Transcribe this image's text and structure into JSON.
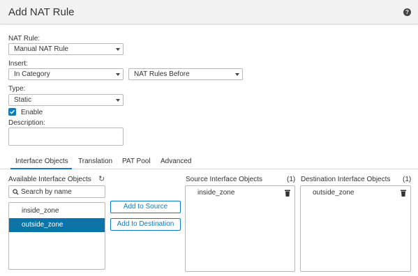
{
  "dialog": {
    "title": "Add NAT Rule",
    "help_icon": "?"
  },
  "form": {
    "nat_rule": {
      "label": "NAT Rule:",
      "value": "Manual NAT Rule"
    },
    "insert": {
      "label": "Insert:",
      "value": "In Category",
      "position_value": "NAT Rules Before"
    },
    "type": {
      "label": "Type:",
      "value": "Static"
    },
    "enable": {
      "label": "Enable",
      "checked": true
    },
    "description": {
      "label": "Description:",
      "value": ""
    }
  },
  "tabs": [
    {
      "label": "Interface Objects",
      "active": true
    },
    {
      "label": "Translation",
      "active": false
    },
    {
      "label": "PAT Pool",
      "active": false
    },
    {
      "label": "Advanced",
      "active": false
    }
  ],
  "available": {
    "title": "Available Interface Objects",
    "refresh_icon": "refresh-icon",
    "search_placeholder": "Search by name",
    "items": [
      {
        "label": "inside_zone",
        "selected": false
      },
      {
        "label": "outside_zone",
        "selected": true
      }
    ]
  },
  "buttons": {
    "add_source": "Add to Source",
    "add_destination": "Add to Destination"
  },
  "source": {
    "title": "Source Interface Objects",
    "count": "(1)",
    "items": [
      "inside_zone"
    ]
  },
  "destination": {
    "title": "Destination Interface Objects",
    "count": "(1)",
    "items": [
      "outside_zone"
    ]
  },
  "colors": {
    "accent": "#0b7bc1",
    "selected_row": "#0e74a8",
    "header_bg": "#f2f2f2"
  }
}
